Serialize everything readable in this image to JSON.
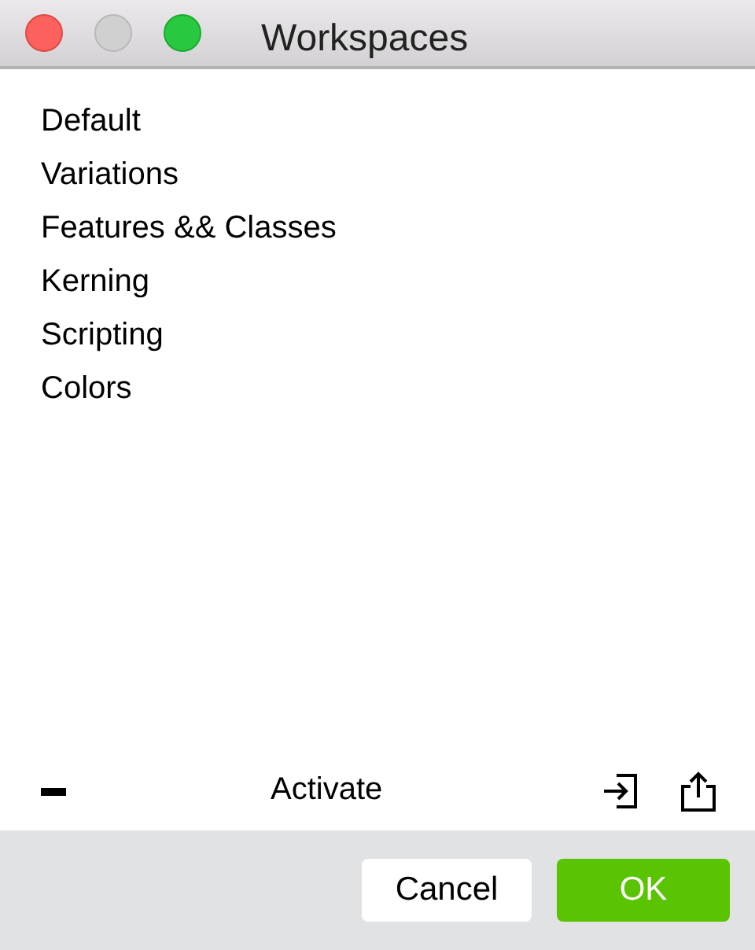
{
  "window": {
    "title": "Workspaces"
  },
  "workspaces": [
    {
      "label": "Default"
    },
    {
      "label": "Variations"
    },
    {
      "label": "Features && Classes"
    },
    {
      "label": "Kerning"
    },
    {
      "label": "Scripting"
    },
    {
      "label": "Colors"
    }
  ],
  "toolbar": {
    "center_label": "Activate"
  },
  "buttons": [
    {
      "label": "Cancel",
      "kind": "secondary"
    },
    {
      "label": "OK",
      "kind": "primary"
    }
  ]
}
